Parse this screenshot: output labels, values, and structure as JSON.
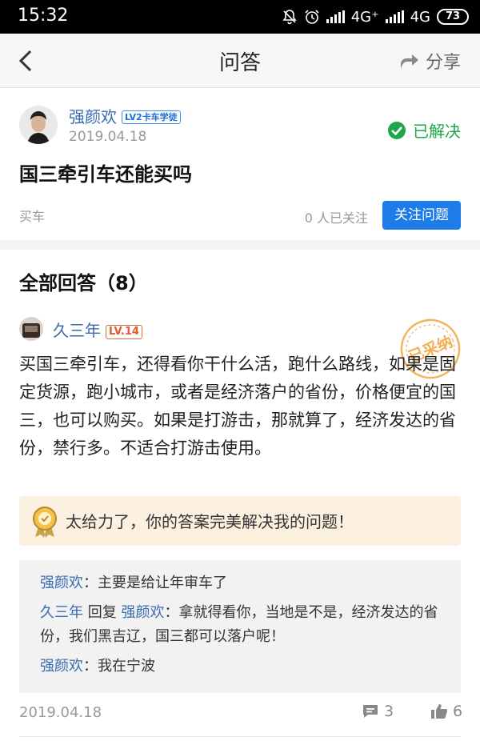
{
  "status_bar": {
    "time": "15:32",
    "network_1": "4G⁺",
    "network_2": "4G",
    "battery": "73",
    "icons": [
      "bell-off-icon",
      "alarm-icon",
      "hd-signal-icon"
    ]
  },
  "nav": {
    "title": "问答",
    "share_label": "分享",
    "back_icon": "chevron-left-icon",
    "share_icon": "share-arrow-icon"
  },
  "question": {
    "author": "强颜欢",
    "badge": "LV2卡车学徒",
    "date": "2019.04.18",
    "status": "已解决",
    "title": "国三牵引车还能买吗",
    "tag": "买车",
    "followers_text": "0 人已关注",
    "follow_button": "关注问题"
  },
  "answers": {
    "header": "全部回答（8）",
    "items": [
      {
        "author": "久三年",
        "level": "LV.14",
        "stamp": "已采纳",
        "body": "买国三牵引车，还得看你干什么活，跑什么路线，如果是固定货源，跑小城市，或者是经济落户的省份，价格便宜的国三，也可以购买。如果是打游击，那就算了，经济发达的省份，禁行多。不适合打游击使用。",
        "praise": "太给力了，你的答案完美解决我的问题！",
        "comments": [
          {
            "user": "强颜欢",
            "sep": "：",
            "text": "主要是给让年审车了",
            "reply": "",
            "reply_to": ""
          },
          {
            "user": "久三年",
            "reply": " 回复 ",
            "reply_to": "强颜欢",
            "sep": "：",
            "text": "拿就得看你，当地是不是，经济发达的省份，我们黑吉辽，国三都可以落户呢！"
          },
          {
            "user": "强颜欢",
            "sep": "：",
            "text": "我在宁波",
            "reply": "",
            "reply_to": ""
          }
        ],
        "date": "2019.04.18",
        "comment_count": "3",
        "like_count": "6"
      }
    ]
  },
  "colors": {
    "accent_blue": "#1e7ce8",
    "link_blue": "#3a6bb0",
    "solved_green": "#1fa64a",
    "praise_bg": "#fcf1e0",
    "stamp_orange": "#f0a640"
  }
}
